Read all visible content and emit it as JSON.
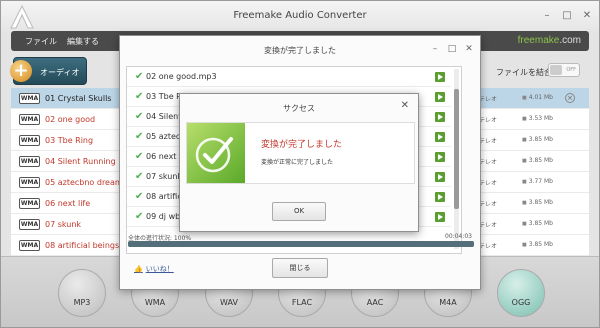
{
  "app": {
    "title": "Freemake Audio Converter",
    "menu": [
      "ファイル",
      "編集する"
    ],
    "brand_main": "freemake",
    "brand_suffix": ".com",
    "add_audio_label": "オーディオ",
    "join_files_label": "ファイルを結合",
    "join_toggle": "OFF"
  },
  "files": [
    {
      "name": "01 Crystal Skulls",
      "channels": "テレオ",
      "size": "4.01 Mb",
      "selected": true
    },
    {
      "name": "02 one good",
      "channels": "テレオ",
      "size": "3.53 Mb"
    },
    {
      "name": "03 Tbe Ring",
      "channels": "テレオ",
      "size": "3.85 Mb"
    },
    {
      "name": "04 Silent Running",
      "channels": "テレオ",
      "size": "3.85 Mb"
    },
    {
      "name": "05 aztecbno dream",
      "channels": "テレオ",
      "size": "3.77 Mb"
    },
    {
      "name": "06 next life",
      "channels": "テレオ",
      "size": "3.85 Mb"
    },
    {
      "name": "07 skunk",
      "channels": "テレオ",
      "size": "3.85 Mb"
    },
    {
      "name": "08 artificial beings",
      "channels": "テレオ",
      "size": "3.85 Mb"
    }
  ],
  "formats": [
    "MP3",
    "WMA",
    "WAV",
    "FLAC",
    "AAC",
    "M4A",
    "OGG"
  ],
  "conversion_dialog": {
    "title": "変換が完了しました",
    "items": [
      "02 one good.mp3",
      "03 Tbe Ri",
      "04 Silent",
      "05 aztecb",
      "06 next li",
      "07 skunk.",
      "08 artifici",
      "09 dj wbe"
    ],
    "progress_label": "全体の進行状況: 100%",
    "progress_value": 100,
    "elapsed": "00:04:03",
    "like_label": "いいね！",
    "close_label": "閉じる"
  },
  "success_dialog": {
    "title": "サクセス",
    "heading": "変換が完了しました",
    "message": "変換が正常に完了しました",
    "ok_label": "OK"
  }
}
